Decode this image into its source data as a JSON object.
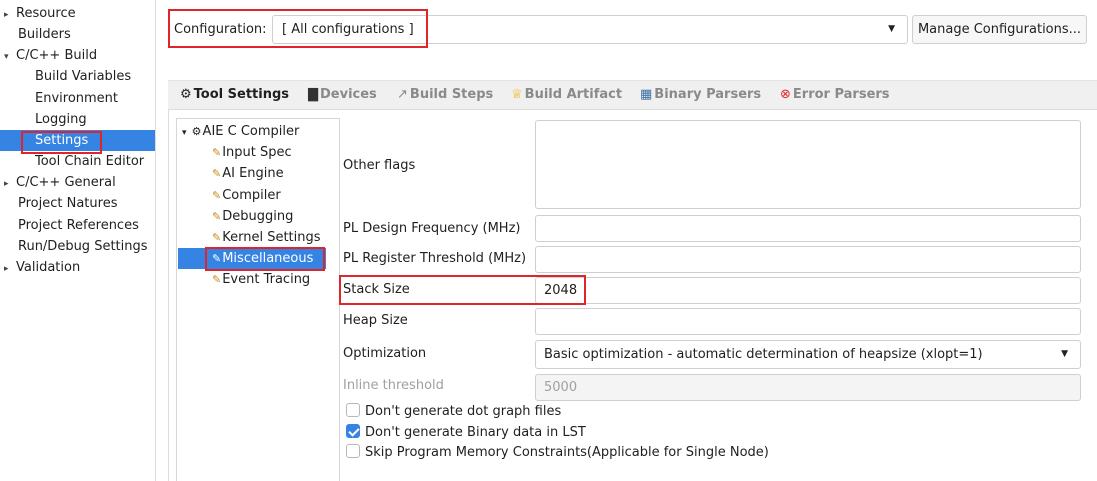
{
  "nav": {
    "items": [
      {
        "label": "Resource",
        "expander": "▸"
      },
      {
        "label": "Builders",
        "expander": ""
      },
      {
        "label": "C/C++ Build",
        "expander": "▾"
      },
      {
        "label": "Build Variables",
        "expander": ""
      },
      {
        "label": "Environment",
        "expander": ""
      },
      {
        "label": "Logging",
        "expander": ""
      },
      {
        "label": "Settings",
        "expander": ""
      },
      {
        "label": "Tool Chain Editor",
        "expander": ""
      },
      {
        "label": "C/C++ General",
        "expander": "▸"
      },
      {
        "label": "Project Natures",
        "expander": ""
      },
      {
        "label": "Project References",
        "expander": ""
      },
      {
        "label": "Run/Debug Settings",
        "expander": ""
      },
      {
        "label": "Validation",
        "expander": "▸"
      }
    ]
  },
  "config": {
    "label": "Configuration:",
    "value": "[ All configurations ]",
    "manage_button": "Manage Configurations..."
  },
  "tabs": [
    {
      "label": "Tool Settings",
      "icon": "⚙"
    },
    {
      "label": "Devices",
      "icon": "▇"
    },
    {
      "label": "Build Steps",
      "icon": "↗"
    },
    {
      "label": "Build Artifact",
      "icon": "♕"
    },
    {
      "label": "Binary Parsers",
      "icon": "▦"
    },
    {
      "label": "Error Parsers",
      "icon": "⊗"
    }
  ],
  "tool_tree": {
    "root": {
      "label": "AIE C Compiler",
      "expander": "▾",
      "icon": "⚙"
    },
    "children": [
      {
        "label": "Input Spec",
        "icon": "✎"
      },
      {
        "label": "AI Engine",
        "icon": "✎"
      },
      {
        "label": "Compiler",
        "icon": "✎"
      },
      {
        "label": "Debugging",
        "icon": "✎"
      },
      {
        "label": "Kernel Settings",
        "icon": "✎"
      },
      {
        "label": "Miscellaneous",
        "icon": "✎"
      },
      {
        "label": "Event Tracing",
        "icon": "✎"
      }
    ]
  },
  "fields": {
    "other_flags": {
      "label": "Other flags",
      "value": ""
    },
    "pl_freq": {
      "label": "PL Design Frequency (MHz)",
      "value": ""
    },
    "pl_reg": {
      "label": "PL Register Threshold (MHz)",
      "value": ""
    },
    "stack_size": {
      "label": "Stack Size",
      "value": "2048"
    },
    "heap_size": {
      "label": "Heap Size",
      "value": ""
    },
    "optimization": {
      "label": "Optimization",
      "value": "Basic optimization - automatic determination of heapsize (xlopt=1)"
    },
    "inline_threshold": {
      "label": "Inline threshold",
      "value": "5000"
    }
  },
  "checkboxes": [
    {
      "label": "Don't generate dot graph files",
      "checked": false
    },
    {
      "label": "Don't generate Binary data in LST",
      "checked": true
    },
    {
      "label": "Skip Program Memory Constraints(Applicable for Single Node)",
      "checked": false
    }
  ],
  "colors": {
    "selection": "#3584e4",
    "highlight_box": "#e0252a"
  }
}
